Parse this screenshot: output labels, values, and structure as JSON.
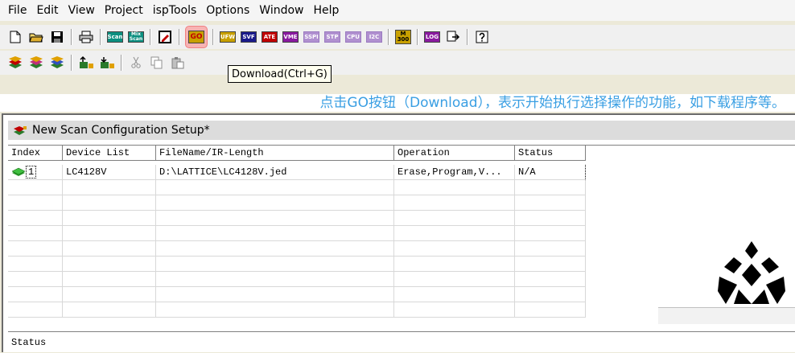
{
  "menu": [
    "File",
    "Edit",
    "View",
    "Project",
    "ispTools",
    "Options",
    "Window",
    "Help"
  ],
  "toolbar1": {
    "scan_label": "Scan",
    "mix_scan_label_1": "Mix",
    "mix_scan_label_2": "Scan",
    "go_label": "GO",
    "ufw_label": "UFW",
    "svf_label": "SVF",
    "ate_label": "ATE",
    "vme_label": "VME",
    "sspi_label": "SSPI",
    "stp_label": "STP",
    "cpu_label": "CPU",
    "i2c_label": "I2C",
    "m300_label_1": "M",
    "m300_label_2": "300",
    "log_label": "LOG"
  },
  "tooltip": "Download(Ctrl+G)",
  "caption": "点击GO按钮（Download），表示开始执行选择操作的功能，如下载程序等。",
  "child_window": {
    "title": "New Scan Configuration Setup*"
  },
  "grid": {
    "columns": [
      "Index",
      "Device List",
      "FileName/IR-Length",
      "Operation",
      "Status"
    ],
    "rows": [
      {
        "index": "1",
        "device": "LC4128V",
        "file": "D:\\LATTICE\\LC4128V.jed",
        "operation": "Erase,Program,V...",
        "status": "N/A"
      }
    ]
  },
  "status_pane": "Status",
  "colors": {
    "caption": "#3a9fe3",
    "go_highlight": "#f7b3b3"
  }
}
